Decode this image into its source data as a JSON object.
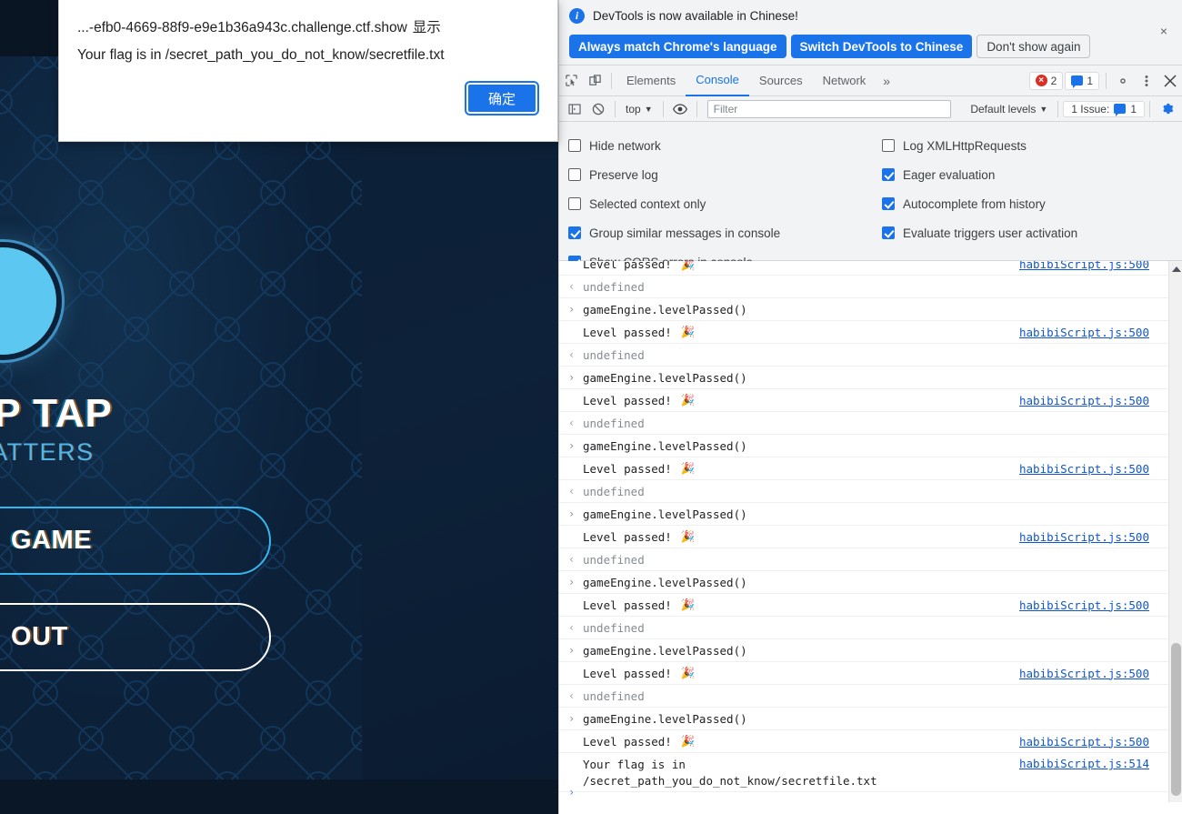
{
  "game": {
    "title": "TAP TAP",
    "subtitle": "P MATTERS",
    "start_button": "GAME",
    "about_button": "OUT"
  },
  "alert": {
    "origin_prefix": "...-efb0-4669-88f9-e9e1b36a943c.challenge.ctf.show",
    "origin_suffix": "显示",
    "message": "Your flag is in /secret_path_you_do_not_know/secretfile.txt",
    "ok_label": "确定"
  },
  "devtools": {
    "infobar": {
      "icon": "info-icon",
      "text": "DevTools is now available in Chinese!",
      "buttons": [
        {
          "label": "Always match Chrome's language",
          "style": "primary"
        },
        {
          "label": "Switch DevTools to Chinese",
          "style": "primary"
        },
        {
          "label": "Don't show again",
          "style": "ghost"
        }
      ],
      "close_icon": "×"
    },
    "tabs": [
      {
        "label": "Elements",
        "active": false
      },
      {
        "label": "Console",
        "active": true
      },
      {
        "label": "Sources",
        "active": false
      },
      {
        "label": "Network",
        "active": false
      }
    ],
    "more_tabs_icon": "»",
    "error_count": "2",
    "message_count": "1",
    "toolbar_icons": {
      "inspect": "inspect-element-icon",
      "device": "device-toolbar-icon",
      "settings": "gear-icon",
      "kebab": "kebab-menu-icon",
      "close": "close-icon"
    },
    "console_toolbar": {
      "sidebar_icon": "console-sidebar-icon",
      "clear_icon": "clear-console-icon",
      "context": "top",
      "eye_icon": "live-expression-icon",
      "filter_placeholder": "Filter",
      "filter_value": "",
      "levels": "Default levels",
      "issues_label": "1 Issue:",
      "issues_count": "1",
      "settings_icon": "gear-icon"
    },
    "settings": {
      "left": [
        {
          "label": "Hide network",
          "checked": false
        },
        {
          "label": "Preserve log",
          "checked": false
        },
        {
          "label": "Selected context only",
          "checked": false
        },
        {
          "label": "Group similar messages in console",
          "checked": true
        },
        {
          "label": "Show CORS errors in console",
          "checked": true
        }
      ],
      "right": [
        {
          "label": "Log XMLHttpRequests",
          "checked": false
        },
        {
          "label": "Eager evaluation",
          "checked": true
        },
        {
          "label": "Autocomplete from history",
          "checked": true
        },
        {
          "label": "Evaluate triggers user activation",
          "checked": true
        }
      ]
    },
    "log": [
      {
        "kind": "output",
        "text": "Level passed!",
        "emoji": "🎉",
        "source": "habibiScript.js:500",
        "clipped": true
      },
      {
        "kind": "result",
        "arrow": "‹",
        "text": "undefined"
      },
      {
        "kind": "input",
        "arrow": "›",
        "text": "gameEngine.levelPassed()"
      },
      {
        "kind": "output",
        "text": "Level passed!",
        "emoji": "🎉",
        "source": "habibiScript.js:500"
      },
      {
        "kind": "result",
        "arrow": "‹",
        "text": "undefined"
      },
      {
        "kind": "input",
        "arrow": "›",
        "text": "gameEngine.levelPassed()"
      },
      {
        "kind": "output",
        "text": "Level passed!",
        "emoji": "🎉",
        "source": "habibiScript.js:500"
      },
      {
        "kind": "result",
        "arrow": "‹",
        "text": "undefined"
      },
      {
        "kind": "input",
        "arrow": "›",
        "text": "gameEngine.levelPassed()"
      },
      {
        "kind": "output",
        "text": "Level passed!",
        "emoji": "🎉",
        "source": "habibiScript.js:500"
      },
      {
        "kind": "result",
        "arrow": "‹",
        "text": "undefined"
      },
      {
        "kind": "input",
        "arrow": "›",
        "text": "gameEngine.levelPassed()"
      },
      {
        "kind": "output",
        "text": "Level passed!",
        "emoji": "🎉",
        "source": "habibiScript.js:500"
      },
      {
        "kind": "result",
        "arrow": "‹",
        "text": "undefined"
      },
      {
        "kind": "input",
        "arrow": "›",
        "text": "gameEngine.levelPassed()"
      },
      {
        "kind": "output",
        "text": "Level passed!",
        "emoji": "🎉",
        "source": "habibiScript.js:500"
      },
      {
        "kind": "result",
        "arrow": "‹",
        "text": "undefined"
      },
      {
        "kind": "input",
        "arrow": "›",
        "text": "gameEngine.levelPassed()"
      },
      {
        "kind": "output",
        "text": "Level passed!",
        "emoji": "🎉",
        "source": "habibiScript.js:500"
      },
      {
        "kind": "result",
        "arrow": "‹",
        "text": "undefined"
      },
      {
        "kind": "input",
        "arrow": "›",
        "text": "gameEngine.levelPassed()"
      },
      {
        "kind": "output",
        "text": "Level passed!",
        "emoji": "🎉",
        "source": "habibiScript.js:500"
      },
      {
        "kind": "output-tall",
        "text": "Your flag is in\n/secret_path_you_do_not_know/secretfile.txt",
        "source": "habibiScript.js:514"
      }
    ],
    "prompt_caret": "›"
  },
  "colors": {
    "accent_blue": "#1a73e8",
    "link_blue": "#1155cc",
    "error_red": "#d93025",
    "game_cyan": "#37b6ee",
    "game_bg": "#0c2038",
    "devtools_chrome": "#f1f3f4"
  }
}
